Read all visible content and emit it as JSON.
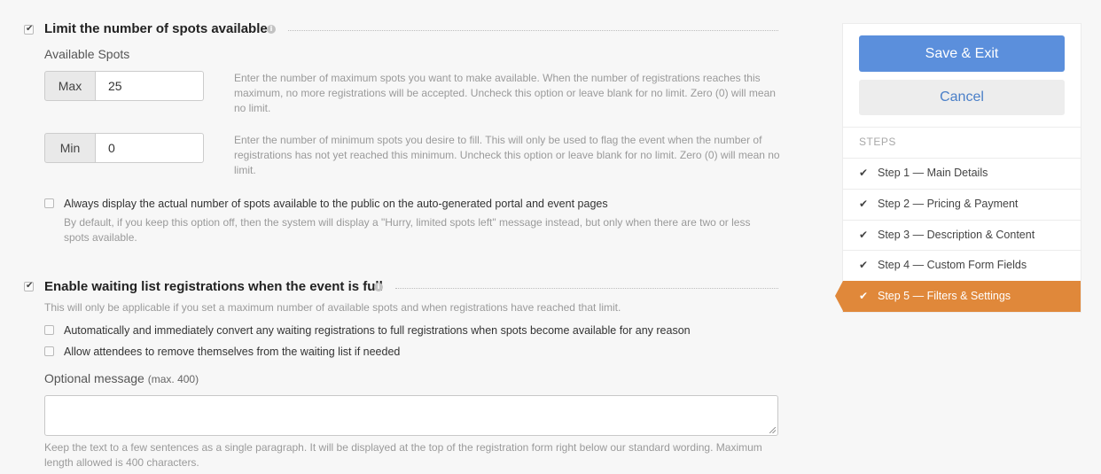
{
  "limit_section": {
    "checked": true,
    "title": "Limit the number of spots available",
    "available_spots_label": "Available Spots",
    "max": {
      "addon": "Max",
      "value": "25",
      "help": "Enter the number of maximum spots you want to make available. When the number of registrations reaches this maximum, no more registrations will be accepted. Uncheck this option or leave blank for no limit. Zero (0) will mean no limit."
    },
    "min": {
      "addon": "Min",
      "value": "0",
      "help": "Enter the number of minimum spots you desire to fill. This will only be used to flag the event when the number of registrations has not yet reached this minimum. Uncheck this option or leave blank for no limit. Zero (0) will mean no limit."
    },
    "display_option": {
      "checked": false,
      "label": "Always display the actual number of spots available to the public on the auto-generated portal and event pages",
      "help": "By default, if you keep this option off, then the system will display a \"Hurry, limited spots left\" message instead, but only when there are two or less spots available."
    }
  },
  "waiting_section": {
    "checked": true,
    "title": "Enable waiting list registrations when the event is full",
    "help": "This will only be applicable if you set a maximum number of available spots and when registrations have reached that limit.",
    "options": [
      {
        "checked": false,
        "label": "Automatically and immediately convert any waiting registrations to full registrations when spots become available for any reason"
      },
      {
        "checked": false,
        "label": "Allow attendees to remove themselves from the waiting list if needed"
      }
    ],
    "optional_message_label": "Optional message",
    "optional_message_hint": "(max. 400)",
    "optional_message_value": "",
    "optional_message_help": "Keep the text to a few sentences as a single paragraph. It will be displayed at the top of the registration form right below our standard wording. Maximum length allowed is 400 characters."
  },
  "sidebar": {
    "save_label": "Save & Exit",
    "cancel_label": "Cancel",
    "steps_heading": "STEPS",
    "steps": [
      {
        "label": "Step 1 — Main Details",
        "done": true,
        "active": false
      },
      {
        "label": "Step 2 — Pricing & Payment",
        "done": true,
        "active": false
      },
      {
        "label": "Step 3 — Description & Content",
        "done": true,
        "active": false
      },
      {
        "label": "Step 4 — Custom Form Fields",
        "done": true,
        "active": false
      },
      {
        "label": "Step 5 — Filters & Settings",
        "done": true,
        "active": true
      }
    ],
    "check_icon": "check-icon",
    "accent_color": "#e0883a",
    "primary_color": "#5b8fdc"
  },
  "info_icon": "info-icon"
}
